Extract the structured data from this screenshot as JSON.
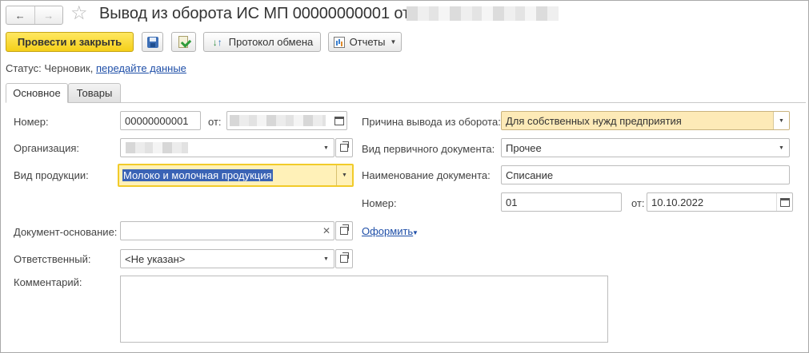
{
  "window": {
    "title": "Вывод из оборота ИС МП 00000000001 от"
  },
  "nav": {
    "back": "←",
    "forward": "→"
  },
  "toolbar": {
    "post_close": "Провести и закрыть",
    "exchange_protocol": "Протокол обмена",
    "reports": "Отчеты"
  },
  "status": {
    "label": "Статус:",
    "value": "Черновик,",
    "link": "передайте данные"
  },
  "tabs": [
    {
      "label": "Основное",
      "active": true
    },
    {
      "label": "Товары",
      "active": false
    }
  ],
  "form": {
    "number": {
      "label": "Номер:",
      "value": "00000000001"
    },
    "date": {
      "label": "от:"
    },
    "organization": {
      "label": "Организация:"
    },
    "product_type": {
      "label": "Вид продукции:",
      "value": "Молоко и молочная продукция"
    },
    "base_document": {
      "label": "Документ-основание:",
      "value": ""
    },
    "responsible": {
      "label": "Ответственный:",
      "value": "<Не указан>"
    },
    "comment": {
      "label": "Комментарий:",
      "value": ""
    },
    "withdrawal_reason": {
      "label": "Причина вывода из оборота:",
      "value": "Для собственных нужд предприятия"
    },
    "primary_doc_type": {
      "label": "Вид первичного документа:",
      "value": "Прочее"
    },
    "doc_name": {
      "label": "Наименование документа:",
      "value": "Списание"
    },
    "doc_number": {
      "label": "Номер:",
      "value": "01"
    },
    "doc_date": {
      "label": "от:",
      "value": "10.10.2022"
    },
    "create_link": "Оформить"
  },
  "colors": {
    "primary_button": "#f5cf19",
    "required_field": "#fdeab7",
    "focus_border": "#f1cb2a",
    "link": "#1f4fa8",
    "selection": "#3a63b5"
  },
  "icons": [
    "arrow-left-icon",
    "arrow-right-icon",
    "star-icon",
    "save-icon",
    "post-icon",
    "exchange-icon",
    "report-icon",
    "dropdown-icon",
    "open-icon",
    "calendar-icon",
    "clear-icon"
  ]
}
